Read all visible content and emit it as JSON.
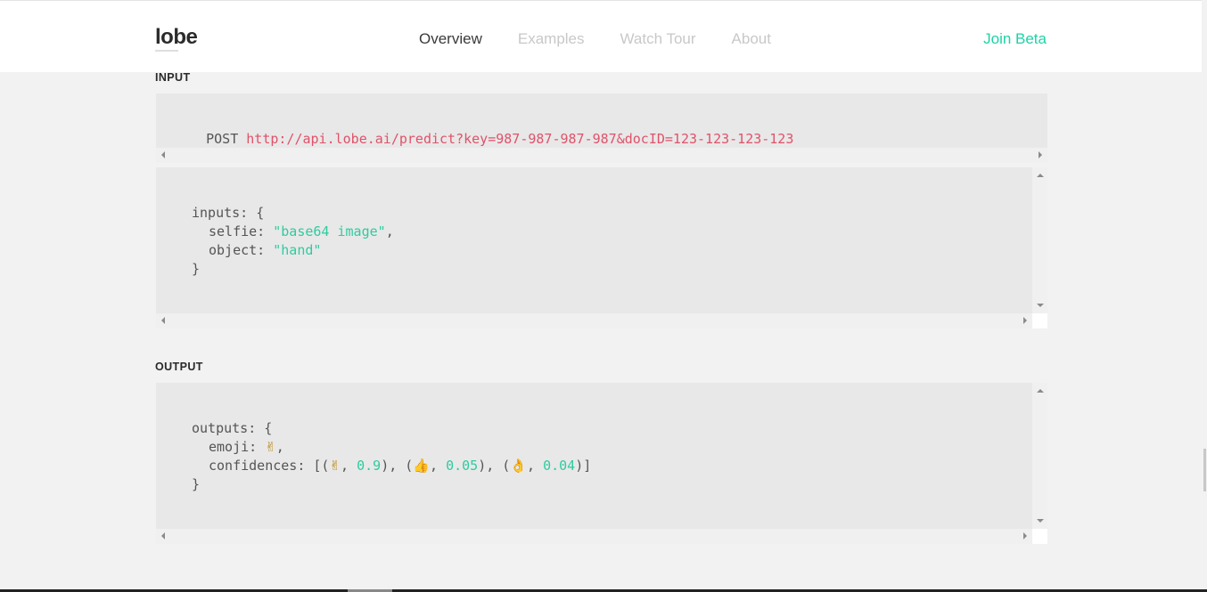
{
  "nav": {
    "logo": "lobe",
    "links": [
      "Overview",
      "Examples",
      "Watch Tour",
      "About"
    ],
    "cta": "Join Beta"
  },
  "input_section": {
    "label": "INPUT",
    "method": "POST",
    "url": "http://api.lobe.ai/predict?key=987-987-987-987&docID=123-123-123-123",
    "body": {
      "line1": "inputs: {",
      "selfie_key": "selfie: ",
      "selfie_val": "\"base64 image\"",
      "comma1": ",",
      "object_key": "object: ",
      "object_val": "\"hand\"",
      "close": "}"
    }
  },
  "output_section": {
    "label": "OUTPUT",
    "body": {
      "line1": "outputs: {",
      "emoji_key": "emoji: ",
      "emoji_val": "✌",
      "comma": ",",
      "conf_key": "confidences: [(",
      "e1": "✌",
      "sep1": ", ",
      "v1": "0.9",
      "mid1": "), (",
      "e2": "👍",
      "sep2": ", ",
      "v2": "0.05",
      "mid2": "), (",
      "e3": "👌",
      "sep3": ", ",
      "v3": "0.04",
      "end": ")]",
      "close": "}"
    }
  },
  "colors": {
    "accent": "#1dd3a7",
    "url": "#e0526a",
    "string": "#2fcb9f",
    "code_bg": "#e8e8e8",
    "page_bg": "#f2f2f2"
  }
}
